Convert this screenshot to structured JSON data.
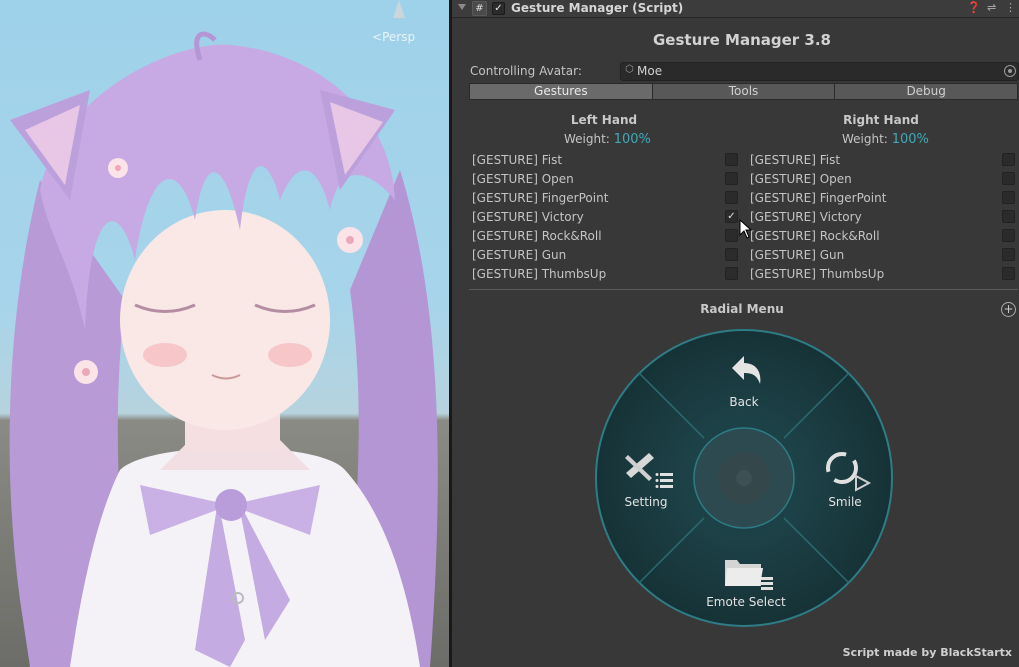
{
  "scene": {
    "view_label": "Persp"
  },
  "component": {
    "title": "Gesture Manager (Script)",
    "enabled": true,
    "header_icons": [
      "help-icon",
      "preset-icon",
      "more-options-icon"
    ]
  },
  "manager": {
    "title": "Gesture Manager 3.8",
    "avatar_label": "Controlling Avatar:",
    "avatar_value": "Moe",
    "tabs": [
      "Gestures",
      "Tools",
      "Debug"
    ],
    "active_tab": "Gestures"
  },
  "left_hand": {
    "title": "Left Hand",
    "weight_label": "Weight:",
    "weight_value": "100%",
    "gestures": [
      {
        "label": "[GESTURE] Fist",
        "checked": false
      },
      {
        "label": "[GESTURE] Open",
        "checked": false
      },
      {
        "label": "[GESTURE] FingerPoint",
        "checked": false
      },
      {
        "label": "[GESTURE] Victory",
        "checked": true
      },
      {
        "label": "[GESTURE] Rock&Roll",
        "checked": false
      },
      {
        "label": "[GESTURE] Gun",
        "checked": false
      },
      {
        "label": "[GESTURE] ThumbsUp",
        "checked": false
      }
    ]
  },
  "right_hand": {
    "title": "Right Hand",
    "weight_label": "Weight:",
    "weight_value": "100%",
    "gestures": [
      {
        "label": "[GESTURE] Fist",
        "checked": false
      },
      {
        "label": "[GESTURE] Open",
        "checked": false
      },
      {
        "label": "[GESTURE] FingerPoint",
        "checked": false
      },
      {
        "label": "[GESTURE] Victory",
        "checked": false
      },
      {
        "label": "[GESTURE] Rock&Roll",
        "checked": false
      },
      {
        "label": "[GESTURE] Gun",
        "checked": false
      },
      {
        "label": "[GESTURE] ThumbsUp",
        "checked": false
      }
    ]
  },
  "radial": {
    "title": "Radial Menu",
    "items": {
      "top": {
        "label": "Back",
        "icon": "back-arrow-icon"
      },
      "left": {
        "label": "Setting",
        "icon": "tools-icon"
      },
      "right": {
        "label": "Smile",
        "icon": "refresh-play-icon"
      },
      "bottom": {
        "label": "Emote Select",
        "icon": "folder-icon"
      }
    }
  },
  "footer": {
    "credit": "Script made by BlackStartx"
  },
  "colors": {
    "accent": "#3fa9b8",
    "panel_bg": "#383838",
    "radial_ring": "#2e7c86"
  }
}
